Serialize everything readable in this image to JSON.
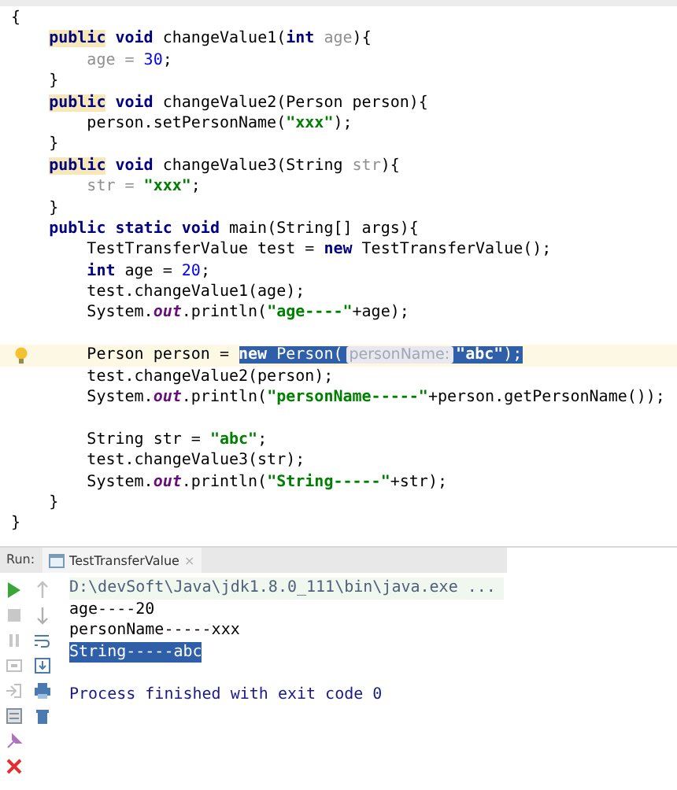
{
  "editor": {
    "lines": [
      {
        "kind": "code",
        "current": false,
        "tokens": [
          {
            "text": "{",
            "kind": "plain"
          }
        ]
      },
      {
        "kind": "code",
        "current": false,
        "tokens": [
          {
            "text": "    public",
            "kind": "marked-keyword"
          },
          {
            "text": " void ",
            "kind": "keyword"
          },
          {
            "text": "changeValue1(",
            "kind": "plain"
          },
          {
            "text": "int ",
            "kind": "keyword"
          },
          {
            "text": "age",
            "kind": "param"
          },
          {
            "text": "){",
            "kind": "plain"
          }
        ]
      },
      {
        "kind": "code",
        "current": false,
        "tokens": [
          {
            "text": "        age = ",
            "kind": "param"
          },
          {
            "text": "30",
            "kind": "number"
          },
          {
            "text": ";",
            "kind": "plain"
          }
        ]
      },
      {
        "kind": "code",
        "current": false,
        "tokens": [
          {
            "text": "    }",
            "kind": "plain"
          }
        ]
      },
      {
        "kind": "code",
        "current": false,
        "tokens": [
          {
            "text": "    public",
            "kind": "marked-keyword"
          },
          {
            "text": " void ",
            "kind": "keyword"
          },
          {
            "text": "changeValue2(Person person){",
            "kind": "plain"
          }
        ]
      },
      {
        "kind": "code",
        "current": false,
        "tokens": [
          {
            "text": "        person.setPersonName(",
            "kind": "plain"
          },
          {
            "text": "\"xxx\"",
            "kind": "string"
          },
          {
            "text": ");",
            "kind": "plain"
          }
        ]
      },
      {
        "kind": "code",
        "current": false,
        "tokens": [
          {
            "text": "    }",
            "kind": "plain"
          }
        ]
      },
      {
        "kind": "code",
        "current": false,
        "tokens": [
          {
            "text": "    public",
            "kind": "marked-keyword"
          },
          {
            "text": " void ",
            "kind": "keyword"
          },
          {
            "text": "changeValue3(String ",
            "kind": "plain"
          },
          {
            "text": "str",
            "kind": "param"
          },
          {
            "text": "){",
            "kind": "plain"
          }
        ]
      },
      {
        "kind": "code",
        "current": false,
        "tokens": [
          {
            "text": "        str = ",
            "kind": "param"
          },
          {
            "text": "\"xxx\"",
            "kind": "string"
          },
          {
            "text": ";",
            "kind": "plain"
          }
        ]
      },
      {
        "kind": "code",
        "current": false,
        "tokens": [
          {
            "text": "    }",
            "kind": "plain"
          }
        ]
      },
      {
        "kind": "code",
        "current": false,
        "tokens": [
          {
            "text": "    public static void ",
            "kind": "keyword"
          },
          {
            "text": "main(String[] args){",
            "kind": "plain"
          }
        ]
      },
      {
        "kind": "code",
        "current": false,
        "tokens": [
          {
            "text": "        TestTransferValue test = ",
            "kind": "plain"
          },
          {
            "text": "new ",
            "kind": "keyword"
          },
          {
            "text": "TestTransferValue();",
            "kind": "plain"
          }
        ]
      },
      {
        "kind": "code",
        "current": false,
        "tokens": [
          {
            "text": "        int ",
            "kind": "keyword"
          },
          {
            "text": "age = ",
            "kind": "plain"
          },
          {
            "text": "20",
            "kind": "number"
          },
          {
            "text": ";",
            "kind": "plain"
          }
        ]
      },
      {
        "kind": "code",
        "current": false,
        "tokens": [
          {
            "text": "        test.changeValue1(age);",
            "kind": "plain"
          }
        ]
      },
      {
        "kind": "code",
        "current": false,
        "tokens": [
          {
            "text": "        System.",
            "kind": "plain"
          },
          {
            "text": "out",
            "kind": "field"
          },
          {
            "text": ".println(",
            "kind": "plain"
          },
          {
            "text": "\"age----\"",
            "kind": "string"
          },
          {
            "text": "+age);",
            "kind": "plain"
          }
        ]
      },
      {
        "kind": "blank",
        "current": false
      },
      {
        "kind": "code",
        "current": true,
        "tokens": [
          {
            "text": "        Person person = ",
            "kind": "plain",
            "selected": false
          },
          {
            "text": "new ",
            "kind": "keyword",
            "selected": true
          },
          {
            "text": "Person(",
            "kind": "plain",
            "selected": true
          },
          {
            "text": "personName:",
            "kind": "hint",
            "selected": true
          },
          {
            "text": "\"abc\"",
            "kind": "string",
            "selected": true
          },
          {
            "text": ");",
            "kind": "plain",
            "selected": true
          }
        ]
      },
      {
        "kind": "code",
        "current": false,
        "tokens": [
          {
            "text": "        test.changeValue2(person);",
            "kind": "plain"
          }
        ]
      },
      {
        "kind": "code",
        "current": false,
        "tokens": [
          {
            "text": "        System.",
            "kind": "plain"
          },
          {
            "text": "out",
            "kind": "field"
          },
          {
            "text": ".println(",
            "kind": "plain"
          },
          {
            "text": "\"personName-----\"",
            "kind": "string"
          },
          {
            "text": "+person.getPersonName());",
            "kind": "plain"
          }
        ]
      },
      {
        "kind": "blank",
        "current": false
      },
      {
        "kind": "code",
        "current": false,
        "tokens": [
          {
            "text": "        String str = ",
            "kind": "plain"
          },
          {
            "text": "\"abc\"",
            "kind": "string"
          },
          {
            "text": ";",
            "kind": "plain"
          }
        ]
      },
      {
        "kind": "code",
        "current": false,
        "tokens": [
          {
            "text": "        test.changeValue3(str);",
            "kind": "plain"
          }
        ]
      },
      {
        "kind": "code",
        "current": false,
        "tokens": [
          {
            "text": "        System.",
            "kind": "plain"
          },
          {
            "text": "out",
            "kind": "field"
          },
          {
            "text": ".println(",
            "kind": "plain"
          },
          {
            "text": "\"String-----\"",
            "kind": "string"
          },
          {
            "text": "+str);",
            "kind": "plain"
          }
        ]
      },
      {
        "kind": "code",
        "current": false,
        "tokens": [
          {
            "text": "    }",
            "kind": "plain"
          }
        ]
      },
      {
        "kind": "code",
        "current": false,
        "tokens": [
          {
            "text": "}",
            "kind": "plain"
          }
        ]
      }
    ]
  },
  "run_panel": {
    "label": "Run:",
    "tabs": [
      {
        "label": "TestTransferValue",
        "close": "×",
        "selected": true
      }
    ],
    "output": [
      {
        "kind": "command",
        "text": "D:\\devSoft\\Java\\jdk1.8.0_111\\bin\\java.exe ...",
        "selected": false
      },
      {
        "kind": "output",
        "text": "age----20",
        "selected": false
      },
      {
        "kind": "output",
        "text": "personName-----xxx",
        "selected": false
      },
      {
        "kind": "output",
        "text": "String-----abc",
        "selected": true
      },
      {
        "kind": "blank",
        "selected": false
      },
      {
        "kind": "info",
        "text": "Process finished with exit code 0",
        "selected": false
      }
    ]
  }
}
